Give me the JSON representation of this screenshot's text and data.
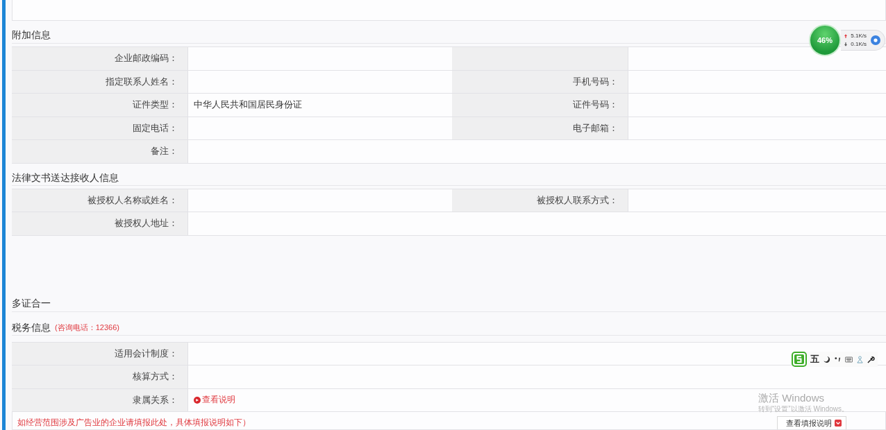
{
  "sections": [
    {
      "title": "附加信息",
      "rows": [
        [
          {
            "kind": "field",
            "label": "企业邮政编码："
          },
          {
            "kind": "blank"
          }
        ],
        [
          {
            "kind": "field",
            "label": "指定联系人姓名："
          },
          {
            "kind": "field",
            "label": "手机号码："
          }
        ],
        [
          {
            "kind": "field",
            "label": "证件类型：",
            "value": "中华人民共和国居民身份证"
          },
          {
            "kind": "field",
            "label": "证件号码："
          }
        ],
        [
          {
            "kind": "field",
            "label": "固定电话："
          },
          {
            "kind": "field",
            "label": "电子邮箱："
          }
        ],
        [
          {
            "kind": "field",
            "label": "备注："
          }
        ]
      ]
    },
    {
      "title": "法律文书送达接收人信息",
      "rows": [
        [
          {
            "kind": "field",
            "label": "被授权人名称或姓名："
          },
          {
            "kind": "field",
            "label": "被授权人联系方式："
          }
        ],
        [
          {
            "kind": "field",
            "label": "被授权人地址："
          }
        ]
      ]
    }
  ],
  "multi_cert": {
    "title": "多证合一"
  },
  "tax": {
    "title": "税务信息",
    "hint": "(咨询电话：12366)",
    "rows": [
      [
        {
          "kind": "field",
          "label": "适用会计制度："
        }
      ],
      [
        {
          "kind": "field",
          "label": "核算方式："
        }
      ],
      [
        {
          "kind": "link",
          "label": "隶属关系：",
          "value": "查看说明"
        }
      ]
    ],
    "note": "如经营范围涉及广告业的企业请填报此处，具体填报说明如下）",
    "button": "查看填报说明"
  },
  "speed_widget": {
    "percent": "46%",
    "upload": "5.1K/s",
    "download": "0.1K/s"
  },
  "ime_toolbar": {
    "mode": "五"
  },
  "os_notice": {
    "title": "激活 Windows",
    "text": "转到“设置”以激活 Windows。"
  }
}
